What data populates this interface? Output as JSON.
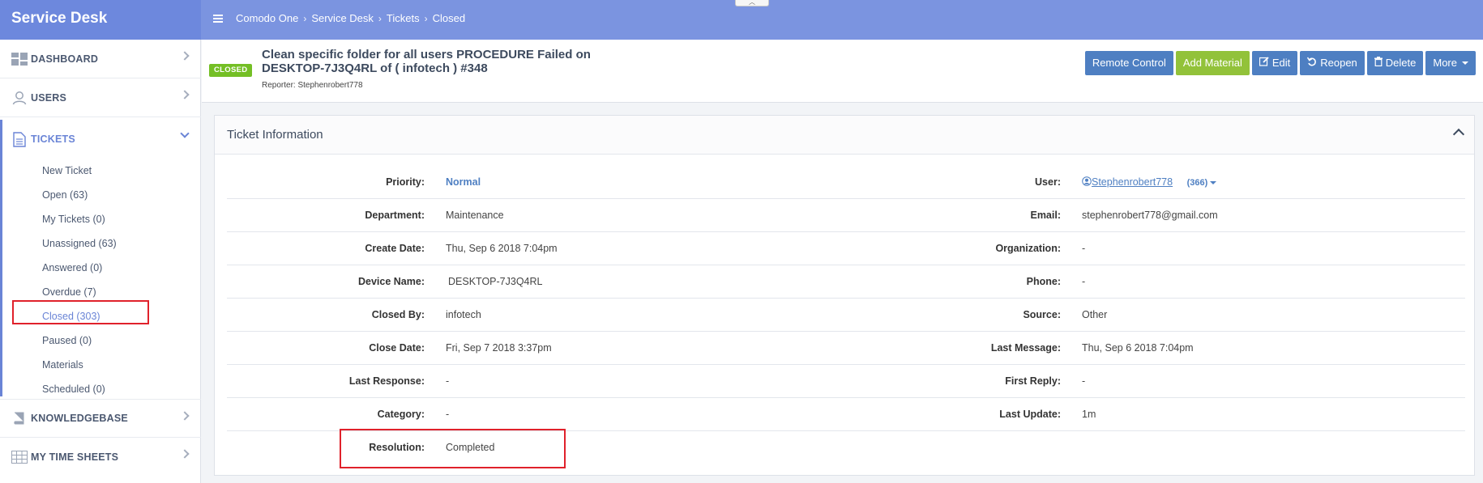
{
  "app": {
    "title": "Service Desk"
  },
  "breadcrumb": [
    "Comodo One",
    "Service Desk",
    "Tickets",
    "Closed"
  ],
  "sidebar": {
    "items": [
      {
        "label": "DASHBOARD",
        "icon": "dashboard-icon"
      },
      {
        "label": "USERS",
        "icon": "user-icon"
      },
      {
        "label": "TICKETS",
        "icon": "document-icon"
      },
      {
        "label": "KNOWLEDGEBASE",
        "icon": "book-icon"
      },
      {
        "label": "MY TIME SHEETS",
        "icon": "table-icon"
      }
    ],
    "tickets_sub": [
      "New Ticket",
      "Open (63)",
      "My Tickets (0)",
      "Unassigned (63)",
      "Answered (0)",
      "Overdue (7)",
      "Closed (303)",
      "Paused (0)",
      "Materials",
      "Scheduled (0)"
    ]
  },
  "ticket": {
    "status": "CLOSED",
    "title": "Clean specific folder for all users PROCEDURE Failed on DESKTOP-7J3Q4RL of ( infotech ) #348",
    "reporter": "Reporter: Stephenrobert778"
  },
  "actions": {
    "remote_control": "Remote Control",
    "add_material": "Add Material",
    "edit": "Edit",
    "reopen": "Reopen",
    "delete": "Delete",
    "more": "More"
  },
  "panel": {
    "title": "Ticket Information",
    "left": [
      {
        "label": "Priority:",
        "value": "Normal"
      },
      {
        "label": "Department:",
        "value": "Maintenance"
      },
      {
        "label": "Create Date:",
        "value": "Thu, Sep 6 2018 7:04pm"
      },
      {
        "label": "Device Name:",
        "value": "DESKTOP-7J3Q4RL"
      },
      {
        "label": "Closed By:",
        "value": "infotech"
      },
      {
        "label": "Close Date:",
        "value": "Fri, Sep 7 2018 3:37pm"
      },
      {
        "label": "Last Response:",
        "value": "-"
      },
      {
        "label": "Category:",
        "value": "-"
      },
      {
        "label": "Resolution:",
        "value": "Completed"
      }
    ],
    "right": [
      {
        "label": "User:",
        "value": "Stephenrobert778",
        "count": "(366)"
      },
      {
        "label": "Email:",
        "value": "stephenrobert778@gmail.com"
      },
      {
        "label": "Organization:",
        "value": "-"
      },
      {
        "label": "Phone:",
        "value": "-"
      },
      {
        "label": "Source:",
        "value": "Other"
      },
      {
        "label": "Last Message:",
        "value": "Thu, Sep 6 2018 7:04pm"
      },
      {
        "label": "First Reply:",
        "value": "-"
      },
      {
        "label": "Last Update:",
        "value": "1m"
      }
    ]
  }
}
